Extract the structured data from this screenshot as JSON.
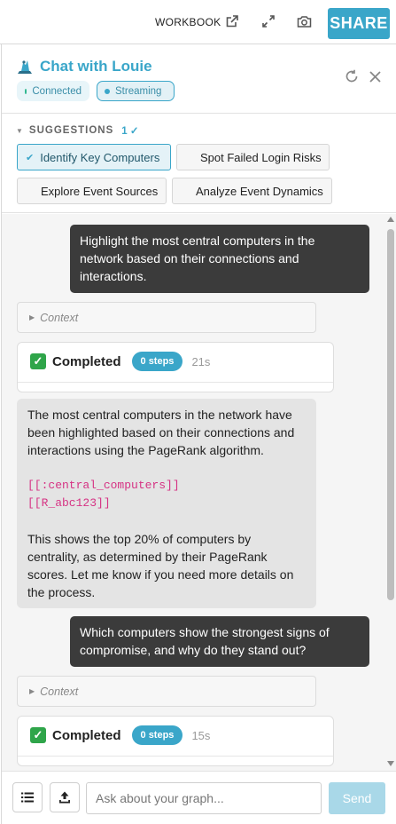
{
  "topbar": {
    "workbook_label": "WORKBOOK",
    "share_label": "SHARE",
    "icons": [
      "external-link-icon",
      "expand-icon",
      "camera-icon"
    ]
  },
  "header": {
    "title": "Chat with Louie",
    "logo_icon": "louie-logo-icon",
    "badges": {
      "connected": "Connected",
      "streaming": "Streaming"
    },
    "icons": [
      "refresh-icon",
      "close-icon"
    ]
  },
  "suggestions": {
    "heading": "SUGGESTIONS",
    "count": "1 ✓",
    "chips": [
      {
        "label": "Identify Key Computers",
        "selected": true
      },
      {
        "label": "Spot Failed Login Risks",
        "selected": false
      },
      {
        "label": "Explore Event Sources",
        "selected": false
      },
      {
        "label": "Analyze Event Dynamics",
        "selected": false
      }
    ]
  },
  "chat": {
    "messages": [
      {
        "role": "user",
        "text": "Highlight the most central computers in the network based on their connections and interactions."
      },
      {
        "role": "context",
        "text": "Context"
      },
      {
        "role": "status",
        "label": "Completed",
        "steps": "0 steps",
        "time": "21s"
      },
      {
        "role": "assistant",
        "p1": "The most central computers in the network have been highlighted based on their connections and interactions using the PageRank algorithm.",
        "code1": "[[:central_computers]]",
        "code2": "[[R_abc123]]",
        "p2": "This shows the top 20% of computers by centrality, as determined by their PageRank scores. Let me know if you need more details on the process."
      },
      {
        "role": "user",
        "text": "Which computers show the strongest signs of compromise, and why do they stand out?"
      },
      {
        "role": "context",
        "text": "Context"
      },
      {
        "role": "status",
        "label": "Completed",
        "steps": "0 steps",
        "time": "15s"
      }
    ]
  },
  "input": {
    "placeholder": "Ask about your graph...",
    "send_label": "Send",
    "icons": [
      "list-icon",
      "upload-icon"
    ]
  },
  "colors": {
    "accent": "#3aa6c9",
    "user_bubble": "#3b3b3b",
    "assistant_bubble": "#e4e4e4",
    "success": "#2fa54a",
    "code": "#d63384"
  }
}
